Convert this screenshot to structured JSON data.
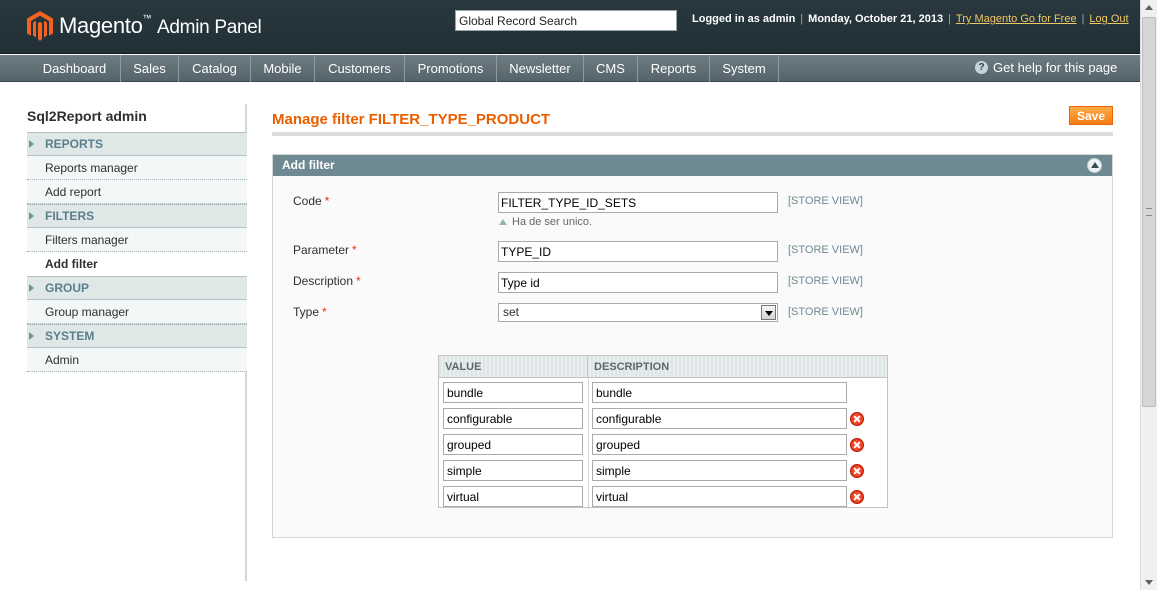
{
  "header": {
    "brand": "Magento",
    "brand_tm": "™",
    "brand_sub": "Admin Panel",
    "search_value": "Global Record Search",
    "logged_in": "Logged in as admin",
    "date": "Monday, October 21, 2013",
    "try_link": "Try Magento Go for Free",
    "logout_link": "Log Out",
    "separator": "|"
  },
  "nav": {
    "items": [
      "Dashboard",
      "Sales",
      "Catalog",
      "Mobile",
      "Customers",
      "Promotions",
      "Newsletter",
      "CMS",
      "Reports",
      "System"
    ],
    "help_label": "Get help for this page",
    "help_glyph": "?"
  },
  "sidebar": {
    "title": "Sql2Report admin",
    "sections": [
      {
        "label": "REPORTS",
        "items": [
          "Reports manager",
          "Add report"
        ]
      },
      {
        "label": "FILTERS",
        "items": [
          "Filters manager",
          "Add filter"
        ]
      },
      {
        "label": "GROUP",
        "items": [
          "Group manager"
        ]
      },
      {
        "label": "SYSTEM",
        "items": [
          "Admin"
        ]
      }
    ],
    "active_item": "Add filter"
  },
  "main": {
    "page_title": "Manage filter FILTER_TYPE_PRODUCT",
    "save_label": "Save",
    "fieldset_title": "Add filter",
    "required_mark": "*",
    "fields": {
      "code": {
        "label": "Code",
        "value": "FILTER_TYPE_ID_SETS",
        "scope": "[STORE VIEW]",
        "note": "Ha de ser unico."
      },
      "parameter": {
        "label": "Parameter",
        "value": "TYPE_ID",
        "scope": "[STORE VIEW]"
      },
      "description": {
        "label": "Description",
        "value": "Type id",
        "scope": "[STORE VIEW]"
      },
      "type": {
        "label": "Type",
        "value": "set",
        "scope": "[STORE VIEW]"
      }
    },
    "options_grid": {
      "headers": [
        "VALUE",
        "DESCRIPTION"
      ],
      "rows": [
        {
          "value": "bundle",
          "description": "bundle",
          "deletable": false
        },
        {
          "value": "configurable",
          "description": "configurable",
          "deletable": true
        },
        {
          "value": "grouped",
          "description": "grouped",
          "deletable": true
        },
        {
          "value": "simple",
          "description": "simple",
          "deletable": true
        },
        {
          "value": "virtual",
          "description": "virtual",
          "deletable": true
        }
      ]
    }
  },
  "colors": {
    "accent": "#eb5e00",
    "header_bg": "#29383f",
    "nav_bg": "#5f6e74",
    "fieldset_head": "#6f8992",
    "sidebar_section_text": "#5b7f8c",
    "link": "#eec866",
    "delete": "#d9280a"
  }
}
